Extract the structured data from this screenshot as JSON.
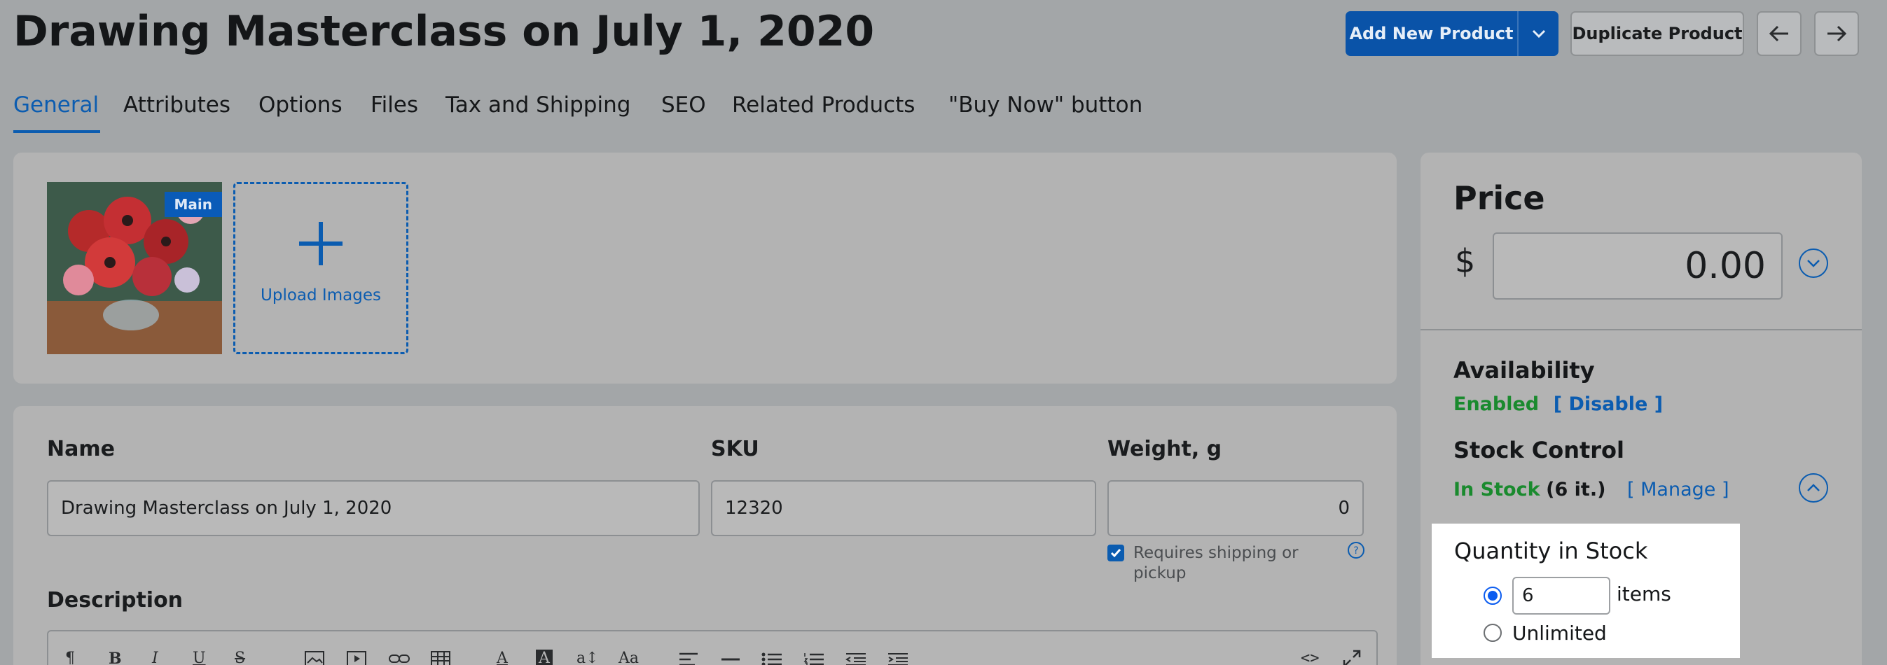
{
  "page": {
    "title": "Drawing Masterclass on July 1, 2020"
  },
  "header_buttons": {
    "add_new_product": "Add New Product",
    "duplicate_product": "Duplicate Product",
    "prev_icon": "arrow-left-icon",
    "next_icon": "arrow-right-icon"
  },
  "tabs": [
    {
      "label": "General",
      "active": true
    },
    {
      "label": "Attributes",
      "active": false
    },
    {
      "label": "Options",
      "active": false
    },
    {
      "label": "Files",
      "active": false
    },
    {
      "label": "Tax and Shipping",
      "active": false
    },
    {
      "label": "SEO",
      "active": false
    },
    {
      "label": "Related Products",
      "active": false
    },
    {
      "label": "\"Buy Now\" button",
      "active": false
    }
  ],
  "images": {
    "main_badge": "Main",
    "upload_label": "Upload Images"
  },
  "fields": {
    "name_label": "Name",
    "name_value": "Drawing Masterclass on July 1, 2020",
    "sku_label": "SKU",
    "sku_value": "12320",
    "weight_label": "Weight, g",
    "weight_value": "0",
    "requires_shipping": "Requires shipping or pickup",
    "requires_shipping_checked": true,
    "description_label": "Description"
  },
  "editor_toolbar": [
    "¶",
    "B",
    "I",
    "U",
    "S",
    "A",
    "A",
    "a↕",
    "Aa",
    "<>"
  ],
  "price": {
    "heading": "Price",
    "currency": "$",
    "value": "0.00"
  },
  "availability": {
    "heading": "Availability",
    "status": "Enabled",
    "action": "[ Disable ]"
  },
  "stock": {
    "heading": "Stock Control",
    "status": "In Stock",
    "count": "(6 it.)",
    "action": "[ Manage ]",
    "quantity_title": "Quantity in Stock",
    "quantity_value": "6",
    "quantity_unit": "items",
    "unlimited_label": "Unlimited",
    "selected": "quantity"
  },
  "colors": {
    "accent": "#0b5cb0",
    "enabled_green": "#1a8a2e",
    "primary_button": "#0a53a8"
  }
}
